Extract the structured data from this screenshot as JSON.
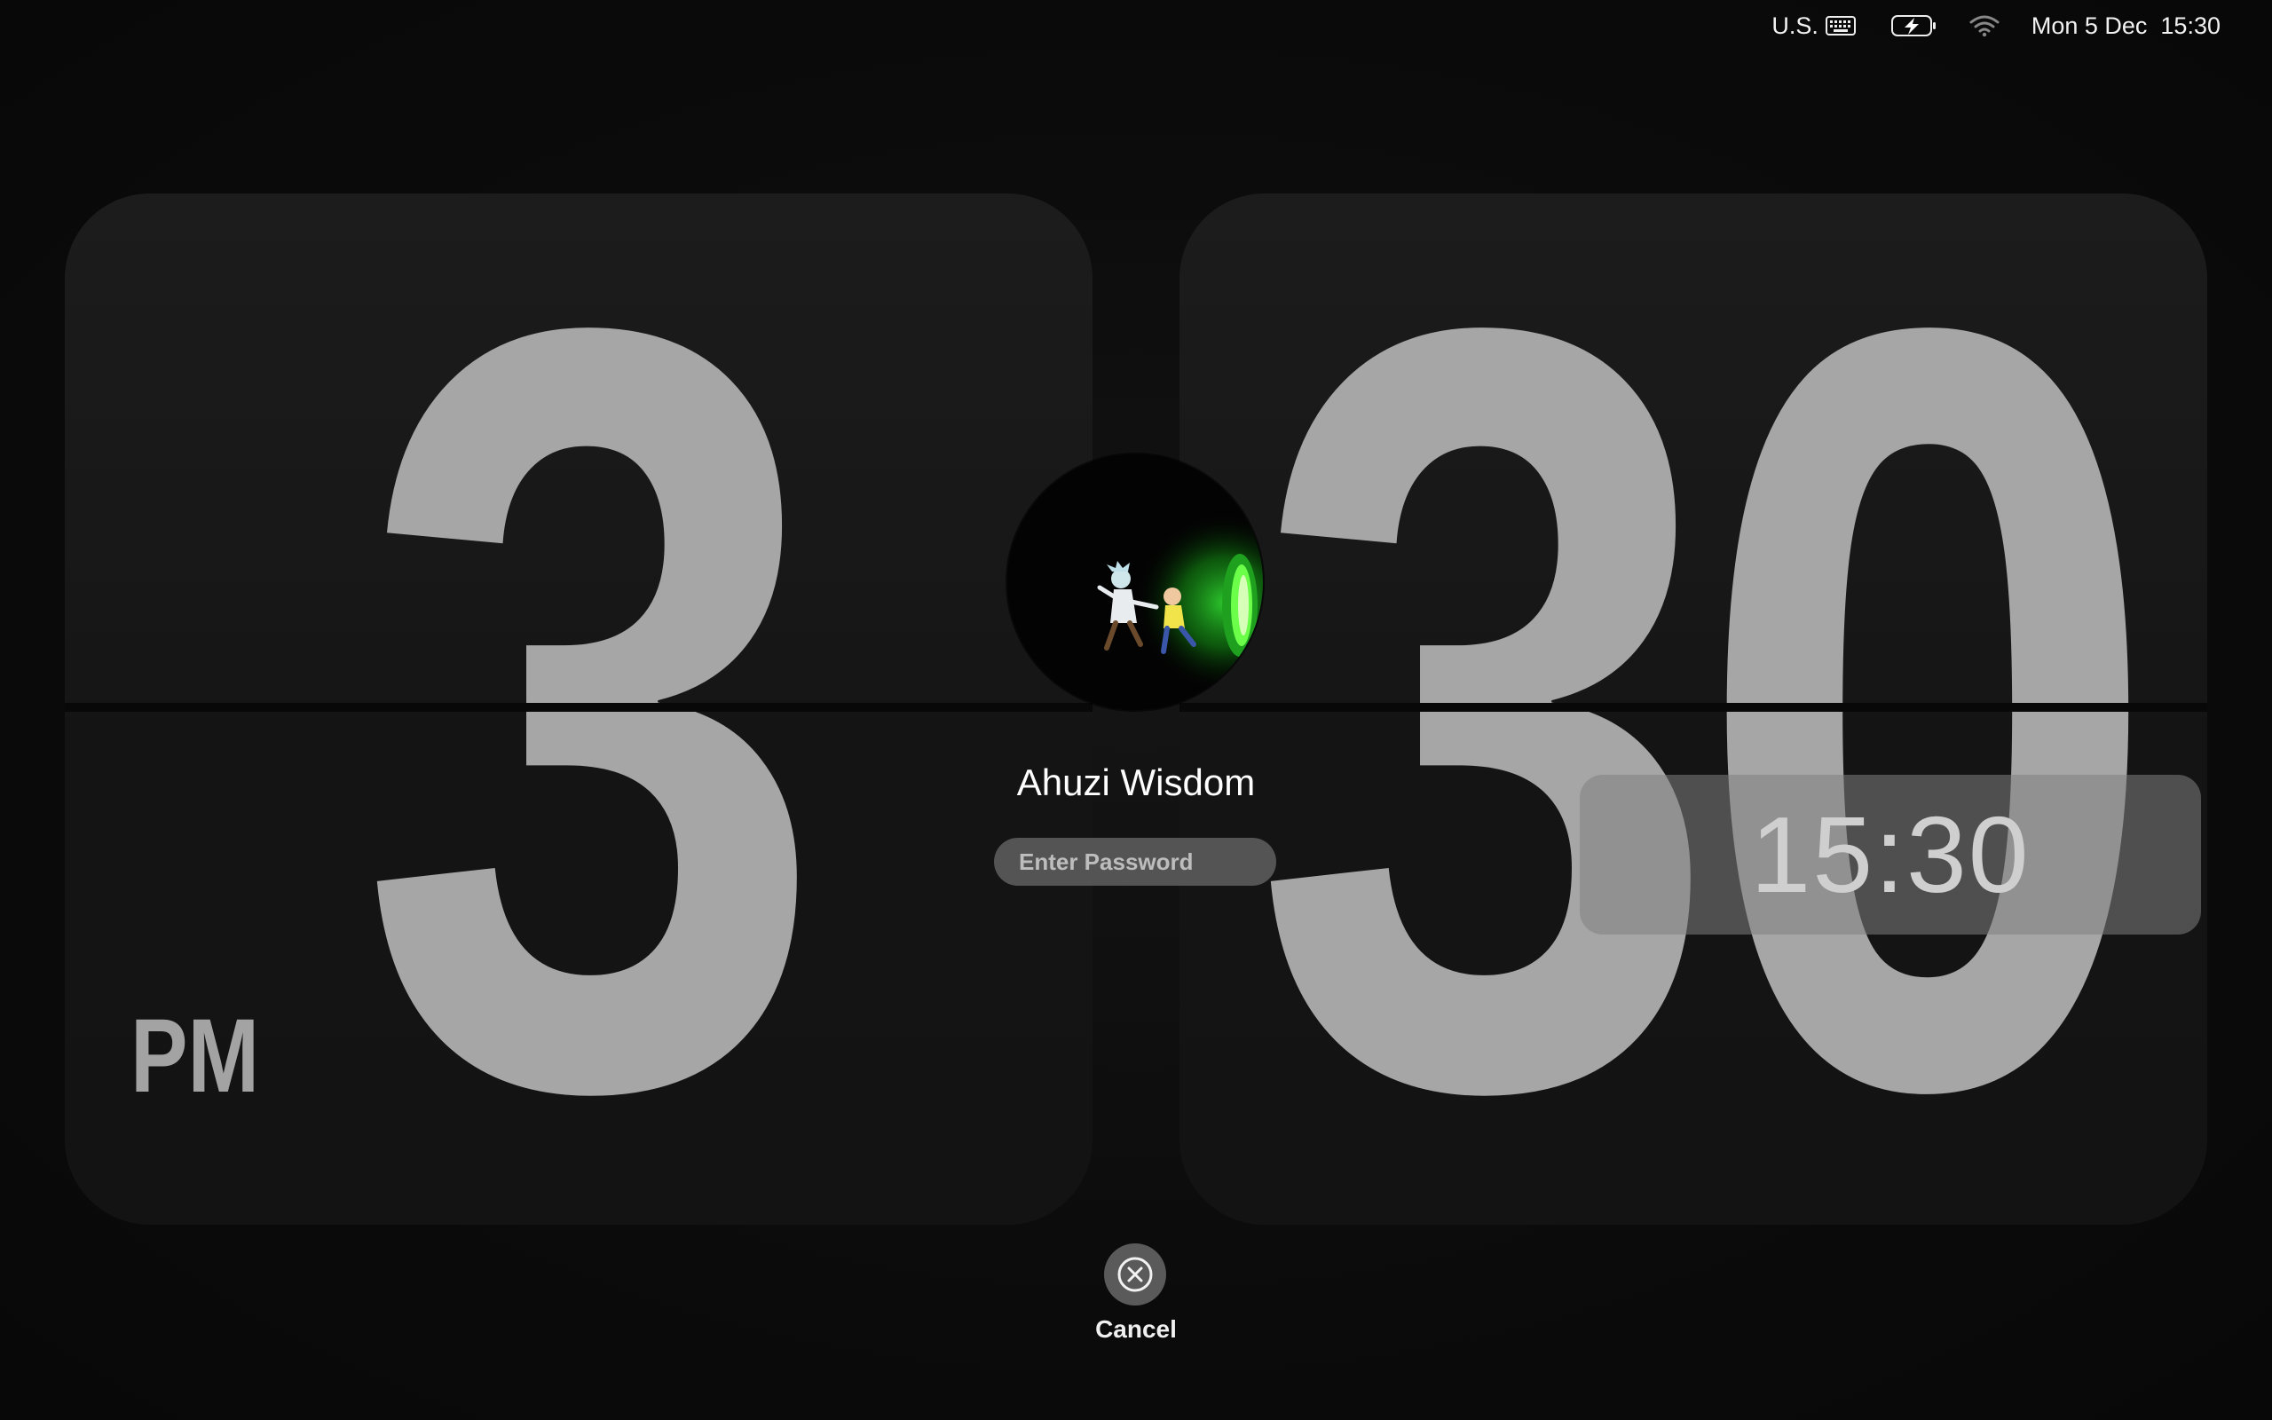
{
  "menubar": {
    "input_source": "U.S.",
    "datetime": "Mon 5 Dec  15:30",
    "icons": [
      "keyboard-icon",
      "battery-charging-icon",
      "wifi-icon"
    ]
  },
  "flip_clock": {
    "hour": "3",
    "minutes": "30",
    "period": "PM"
  },
  "overlay_clock": {
    "time": "15:30"
  },
  "login": {
    "user_name": "Ahuzi Wisdom",
    "password_placeholder": "Enter Password",
    "password_value": "",
    "cancel_label": "Cancel"
  },
  "colors": {
    "background": "#0a0a0a",
    "card": "#161616",
    "digits": "#a6a6a6",
    "portal_green": "#3be03b"
  }
}
